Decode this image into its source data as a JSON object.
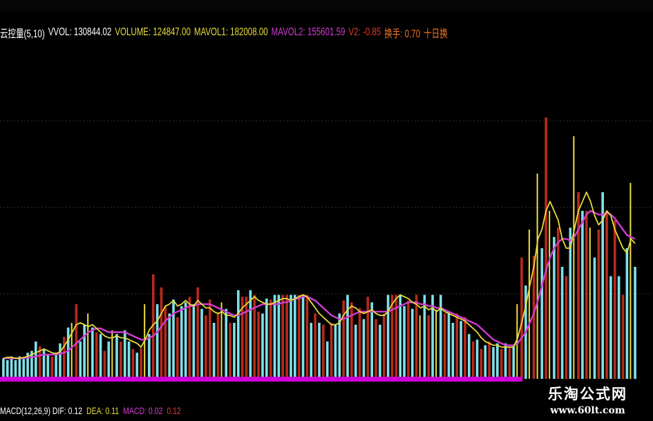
{
  "colors": {
    "background": "#000000",
    "up_bar": "#b82a1a",
    "down_bar": "#7fe0e8",
    "highlight_bar": "#f0e040",
    "ma_short": "#e8dc3c",
    "ma_long": "#d23cd2",
    "grid": "#333333",
    "text_white": "#ffffff",
    "text_yellow": "#e8dc3c",
    "text_magenta": "#d23cd2",
    "text_red": "#e03a2a",
    "text_orange": "#f07820",
    "baseline": "#d000d8"
  },
  "header": {
    "indicator_name": "云控量(5,10)",
    "vvol": "VVOL: 130844.02",
    "volume": "VOLUME: 124847.00",
    "mavol1": "MAVOL1: 182008.00",
    "mavol2": "MAVOL2: 155601.59",
    "v2": "V2: -0.85",
    "turnover": "换手: 0.70",
    "ten_day": "十日换"
  },
  "footer": {
    "macd": "MACD(12,26,9) DIF: 0.12",
    "dea": "DEA: 0.11",
    "macd_value": "MACD: 0.02",
    "extra": "0.12"
  },
  "watermark": {
    "name": "乐淘公式网",
    "url": "www.60lt.com"
  },
  "chart_data": {
    "type": "bar",
    "title": "云控量(5,10)",
    "description_axes": "volume columns per trading session with two moving-average lines; axis tick labels not printed",
    "ylim": [
      0,
      300
    ],
    "grid": true,
    "series": [
      {
        "name": "VOLUME",
        "values": [
          22,
          20,
          24,
          20,
          24,
          22,
          28,
          30,
          40,
          35,
          32,
          26,
          24,
          28,
          38,
          45,
          55,
          60,
          80,
          40,
          58,
          70,
          55,
          50,
          48,
          30,
          40,
          52,
          48,
          40,
          52,
          40,
          32,
          28,
          33,
          80,
          48,
          112,
          80,
          98,
          78,
          70,
          85,
          66,
          78,
          82,
          88,
          80,
          98,
          75,
          68,
          85,
          60,
          70,
          82,
          75,
          60,
          60,
          95,
          88,
          88,
          95,
          90,
          72,
          70,
          86,
          85,
          90,
          90,
          90,
          90,
          90,
          90,
          90,
          90,
          90,
          60,
          70,
          60,
          58,
          40,
          60,
          58,
          70,
          84,
          90,
          82,
          58,
          76,
          64,
          88,
          82,
          64,
          58,
          70,
          90,
          90,
          90,
          90,
          78,
          84,
          75,
          90,
          68,
          90,
          68,
          90,
          74,
          90,
          70,
          72,
          60,
          70,
          62,
          66,
          48,
          40,
          42,
          32,
          36,
          40,
          34,
          38,
          32,
          38,
          34,
          35,
          80,
          130,
          100,
          160,
          132,
          220,
          140,
          280,
          180,
          152,
          162,
          120,
          110,
          162,
          260,
          200,
          180,
          180,
          162,
          130,
          160,
          200,
          180,
          110,
          170,
          110,
          90,
          140,
          210,
          120
        ],
        "colors": [
          "c",
          "c",
          "c",
          "c",
          "c",
          "c",
          "c",
          "c",
          "c",
          "r",
          "c",
          "c",
          "r",
          "c",
          "c",
          "r",
          "c",
          "y",
          "r",
          "c",
          "c",
          "y",
          "c",
          "r",
          "c",
          "r",
          "c",
          "y",
          "c",
          "r",
          "c",
          "c",
          "r",
          "c",
          "r",
          "y",
          "c",
          "r",
          "c",
          "r",
          "r",
          "c",
          "c",
          "r",
          "c",
          "c",
          "r",
          "c",
          "r",
          "c",
          "r",
          "r",
          "c",
          "r",
          "y",
          "c",
          "r",
          "c",
          "c",
          "r",
          "r",
          "c",
          "r",
          "r",
          "c",
          "c",
          "r",
          "c",
          "c",
          "r",
          "r",
          "c",
          "c",
          "r",
          "c",
          "r",
          "c",
          "r",
          "c",
          "r",
          "c",
          "r",
          "c",
          "c",
          "r",
          "c",
          "r",
          "c",
          "r",
          "c",
          "r",
          "c",
          "r",
          "c",
          "r",
          "c",
          "r",
          "r",
          "c",
          "c",
          "r",
          "c",
          "r",
          "y",
          "c",
          "r",
          "c",
          "y",
          "c",
          "r",
          "c",
          "c",
          "r",
          "c",
          "r",
          "c",
          "r",
          "c",
          "r",
          "c",
          "r",
          "c",
          "c",
          "r",
          "c",
          "r",
          "c",
          "y",
          "r",
          "c",
          "y",
          "r",
          "y",
          "c",
          "r",
          "y",
          "c",
          "r",
          "c",
          "r",
          "c",
          "y",
          "r",
          "c",
          "r",
          "y",
          "c",
          "r",
          "c",
          "r",
          "c",
          "r",
          "c",
          "r",
          "c",
          "y",
          "c"
        ]
      },
      {
        "name": "MAVOL1",
        "values": [
          22,
          23,
          23,
          22,
          22,
          23,
          24,
          26,
          28,
          30,
          32,
          30,
          28,
          27,
          29,
          35,
          42,
          50,
          58,
          60,
          58,
          56,
          58,
          54,
          50,
          46,
          44,
          44,
          46,
          44,
          44,
          42,
          40,
          38,
          34,
          42,
          52,
          58,
          62,
          70,
          78,
          80,
          84,
          78,
          80,
          84,
          80,
          78,
          84,
          80,
          76,
          76,
          72,
          70,
          72,
          68,
          68,
          66,
          70,
          76,
          80,
          84,
          88,
          84,
          82,
          80,
          80,
          82,
          84,
          86,
          86,
          84,
          86,
          88,
          90,
          88,
          82,
          76,
          70,
          66,
          62,
          58,
          58,
          60,
          68,
          74,
          78,
          76,
          72,
          70,
          72,
          74,
          70,
          68,
          68,
          72,
          80,
          86,
          90,
          88,
          86,
          82,
          80,
          76,
          78,
          74,
          76,
          72,
          76,
          72,
          70,
          68,
          66,
          64,
          62,
          58,
          54,
          50,
          44,
          40,
          38,
          36,
          36,
          34,
          34,
          34,
          34,
          44,
          60,
          78,
          100,
          120,
          150,
          160,
          180,
          190,
          180,
          170,
          150,
          140,
          140,
          160,
          180,
          190,
          200,
          190,
          175,
          165,
          170,
          180,
          175,
          160,
          150,
          140,
          135,
          150,
          145
        ],
        "role": "ma_short"
      },
      {
        "name": "MAVOL2",
        "values": [
          22,
          22,
          22,
          22,
          22,
          22,
          23,
          23,
          24,
          25,
          26,
          26,
          26,
          26,
          27,
          28,
          30,
          34,
          38,
          42,
          46,
          50,
          52,
          54,
          54,
          52,
          50,
          50,
          50,
          50,
          50,
          48,
          46,
          44,
          42,
          42,
          44,
          46,
          50,
          56,
          62,
          66,
          70,
          72,
          74,
          76,
          78,
          78,
          80,
          80,
          80,
          80,
          78,
          76,
          74,
          72,
          70,
          68,
          68,
          70,
          72,
          74,
          76,
          78,
          80,
          80,
          80,
          80,
          80,
          82,
          82,
          84,
          86,
          86,
          88,
          88,
          86,
          84,
          80,
          76,
          72,
          68,
          66,
          64,
          64,
          66,
          68,
          70,
          72,
          72,
          72,
          72,
          72,
          72,
          72,
          72,
          74,
          76,
          78,
          80,
          82,
          82,
          82,
          80,
          80,
          78,
          78,
          76,
          76,
          74,
          72,
          70,
          68,
          66,
          64,
          62,
          60,
          58,
          54,
          50,
          46,
          42,
          40,
          38,
          36,
          36,
          36,
          38,
          44,
          50,
          60,
          70,
          84,
          100,
          116,
          130,
          140,
          146,
          150,
          150,
          148,
          152,
          160,
          168,
          176,
          180,
          178,
          176,
          176,
          178,
          176,
          172,
          166,
          160,
          154,
          152,
          150
        ],
        "role": "ma_long"
      }
    ]
  }
}
